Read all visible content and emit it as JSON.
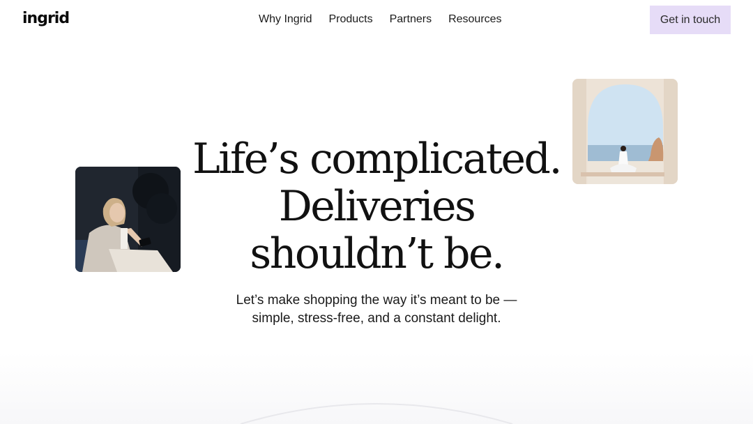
{
  "header": {
    "logo": "ingrid",
    "nav": [
      "Why Ingrid",
      "Products",
      "Partners",
      "Resources"
    ],
    "cta_label": "Get in touch",
    "cta_color": "#e6dcf7"
  },
  "hero": {
    "headline_lines": [
      "Life’s complicated.",
      "Deliveries",
      "shouldn’t be."
    ],
    "subheading_lines": [
      "Let’s make shopping the way it’s meant to be —",
      "simple, stress-free, and a constant delight."
    ]
  }
}
